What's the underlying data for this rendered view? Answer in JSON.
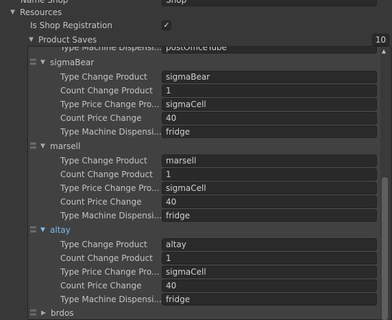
{
  "top_field": {
    "label": "Name Shop",
    "value": "Shop"
  },
  "resources": {
    "label": "Resources"
  },
  "is_shop_registration": {
    "label": "Is Shop Registration",
    "check_glyph": "✓"
  },
  "product_saves": {
    "label": "Product Saves",
    "count": "10"
  },
  "partial_item": {
    "label": "Type Machine Dispensi...",
    "value": "postOfficeTube"
  },
  "items": [
    {
      "name": "sigmaBear",
      "fields": [
        {
          "label": "Type Change Product",
          "value": "sigmaBear"
        },
        {
          "label": "Count Change Product",
          "value": "1"
        },
        {
          "label": "Type Price Change Pro...",
          "value": "sigmaCell"
        },
        {
          "label": "Count Price Change",
          "value": "40"
        },
        {
          "label": "Type Machine Dispensi...",
          "value": "fridge"
        }
      ]
    },
    {
      "name": "marsell",
      "fields": [
        {
          "label": "Type Change Product",
          "value": "marsell"
        },
        {
          "label": "Count Change Product",
          "value": "1"
        },
        {
          "label": "Type Price Change Pro...",
          "value": "sigmaCell"
        },
        {
          "label": "Count Price Change",
          "value": "40"
        },
        {
          "label": "Type Machine Dispensi...",
          "value": "fridge"
        }
      ]
    },
    {
      "name": "altay",
      "fields": [
        {
          "label": "Type Change Product",
          "value": "altay"
        },
        {
          "label": "Count Change Product",
          "value": "1"
        },
        {
          "label": "Type Price Change Pro...",
          "value": "sigmaCell"
        },
        {
          "label": "Count Price Change",
          "value": "40"
        },
        {
          "label": "Type Machine Dispensi...",
          "value": "fridge"
        }
      ]
    },
    {
      "name": "brdos"
    }
  ],
  "icons": {
    "expanded": "▼",
    "collapsed": "▶",
    "drag": "〓",
    "scroll_up": "▲"
  },
  "colors": {
    "background": "#383838",
    "field": "#2a2a2a",
    "highlight": "#7fb8ee"
  }
}
